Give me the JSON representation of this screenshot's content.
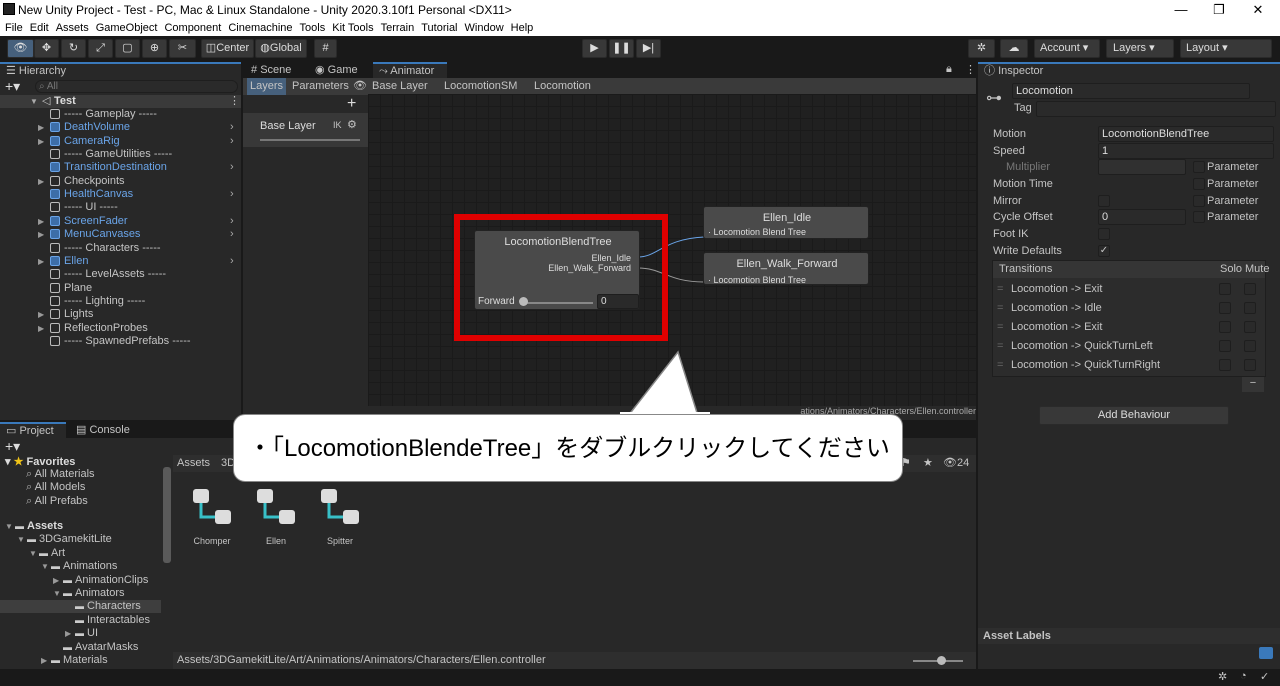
{
  "window": {
    "title": "New Unity Project - Test - PC, Mac & Linux Standalone - Unity 2020.3.10f1 Personal <DX11>",
    "min": "—",
    "max": "❐",
    "close": "✕"
  },
  "menu": [
    "File",
    "Edit",
    "Assets",
    "GameObject",
    "Component",
    "Cinemachine",
    "Tools",
    "Kit Tools",
    "Terrain",
    "Tutorial",
    "Window",
    "Help"
  ],
  "toolbar": {
    "center": "Center",
    "global": "Global",
    "account": "Account ▾",
    "layers": "Layers ▾",
    "layout": "Layout ▾"
  },
  "hierarchy": {
    "tab": "Hierarchy",
    "search": "All",
    "scene": "Test",
    "items": [
      {
        "label": "----- Gameplay -----",
        "indent": 1,
        "blue": false,
        "arrow": false,
        "chev": false
      },
      {
        "label": "DeathVolume",
        "indent": 1,
        "blue": true,
        "arrow": true,
        "chev": true
      },
      {
        "label": "CameraRig",
        "indent": 1,
        "blue": true,
        "arrow": true,
        "chev": true
      },
      {
        "label": "----- GameUtilities -----",
        "indent": 1,
        "blue": false,
        "arrow": false,
        "chev": false
      },
      {
        "label": "TransitionDestination",
        "indent": 1,
        "blue": true,
        "arrow": false,
        "chev": true
      },
      {
        "label": "Checkpoints",
        "indent": 1,
        "blue": false,
        "arrow": true,
        "chev": false
      },
      {
        "label": "HealthCanvas",
        "indent": 1,
        "blue": true,
        "arrow": false,
        "chev": true
      },
      {
        "label": "----- UI -----",
        "indent": 1,
        "blue": false,
        "arrow": false,
        "chev": false
      },
      {
        "label": "ScreenFader",
        "indent": 1,
        "blue": true,
        "arrow": true,
        "chev": true
      },
      {
        "label": "MenuCanvases",
        "indent": 1,
        "blue": true,
        "arrow": true,
        "chev": true
      },
      {
        "label": "----- Characters -----",
        "indent": 1,
        "blue": false,
        "arrow": false,
        "chev": false
      },
      {
        "label": "Ellen",
        "indent": 1,
        "blue": true,
        "arrow": true,
        "chev": true
      },
      {
        "label": "----- LevelAssets -----",
        "indent": 1,
        "blue": false,
        "arrow": false,
        "chev": false
      },
      {
        "label": "Plane",
        "indent": 1,
        "blue": false,
        "arrow": false,
        "chev": false
      },
      {
        "label": "----- Lighting -----",
        "indent": 1,
        "blue": false,
        "arrow": false,
        "chev": false
      },
      {
        "label": "Lights",
        "indent": 1,
        "blue": false,
        "arrow": true,
        "chev": false
      },
      {
        "label": "ReflectionProbes",
        "indent": 1,
        "blue": false,
        "arrow": true,
        "chev": false
      },
      {
        "label": "----- SpawnedPrefabs -----",
        "indent": 1,
        "blue": false,
        "arrow": false,
        "chev": false
      }
    ]
  },
  "tabs": {
    "scene": "Scene",
    "game": "Game",
    "animator": "Animator",
    "inspector": "Inspector",
    "project": "Project",
    "console": "Console"
  },
  "animator": {
    "layers": "Layers",
    "parameters": "Parameters",
    "crumbs": [
      "Base Layer",
      "LocomotionSM",
      "Locomotion"
    ],
    "baseLayer": "Base Layer",
    "ik": "IK",
    "blend": {
      "title": "LocomotionBlendTree",
      "out1": "Ellen_Idle",
      "out2": "Ellen_Walk_Forward",
      "param": "Forward",
      "value": "0"
    },
    "node1": {
      "title": "Ellen_Idle",
      "sub": "Locomotion Blend Tree"
    },
    "node2": {
      "title": "Ellen_Walk_Forward",
      "sub": "Locomotion Blend Tree"
    },
    "path": "Assets/3DGamekitLite/Art/Animations/Animators/Characters/Ellen.controller",
    "pathVisible": "ations/Animators/Characters/Ellen.controller"
  },
  "inspector": {
    "name": "Locomotion",
    "tag": "Tag",
    "fields": [
      {
        "label": "Motion",
        "value": "LocomotionBlendTree"
      },
      {
        "label": "Speed",
        "value": "1"
      },
      {
        "label": "Multiplier",
        "value": ""
      },
      {
        "label": "Motion Time",
        "value": ""
      },
      {
        "label": "Mirror",
        "value": ""
      },
      {
        "label": "Cycle Offset",
        "value": "0"
      },
      {
        "label": "Foot IK",
        "value": ""
      },
      {
        "label": "Write Defaults",
        "value": ""
      }
    ],
    "parameter": "Parameter",
    "transitions": "Transitions",
    "solo": "Solo",
    "mute": "Mute",
    "trans": [
      "Locomotion -> Exit",
      "Locomotion -> Idle",
      "Locomotion -> Exit",
      "Locomotion -> QuickTurnLeft",
      "Locomotion -> QuickTurnRight"
    ],
    "addBehaviour": "Add Behaviour",
    "assetLabels": "Asset Labels"
  },
  "project": {
    "favorites": "Favorites",
    "fav": [
      "All Materials",
      "All Models",
      "All Prefabs"
    ],
    "tree": [
      {
        "label": "Assets",
        "d": 0,
        "bold": true
      },
      {
        "label": "3DGamekitLite",
        "d": 1
      },
      {
        "label": "Art",
        "d": 2
      },
      {
        "label": "Animations",
        "d": 3
      },
      {
        "label": "AnimationClips",
        "d": 4
      },
      {
        "label": "Animators",
        "d": 4
      },
      {
        "label": "Characters",
        "d": 5,
        "sel": true
      },
      {
        "label": "Interactables",
        "d": 5
      },
      {
        "label": "UI",
        "d": 5
      },
      {
        "label": "AvatarMasks",
        "d": 4
      },
      {
        "label": "Materials",
        "d": 3
      }
    ],
    "crumb": "Assets",
    "crumb2": "3D",
    "assets": [
      "Chomper",
      "Ellen",
      "Spitter"
    ],
    "count": "24",
    "footer": "Assets/3DGamekitLite/Art/Animations/Animators/Characters/Ellen.controller"
  },
  "callout": "・「LocomotionBlendeTree」をダブルクリックしてください",
  "colors": {
    "highlight": "#e00000",
    "accent": "#3a79bb"
  }
}
